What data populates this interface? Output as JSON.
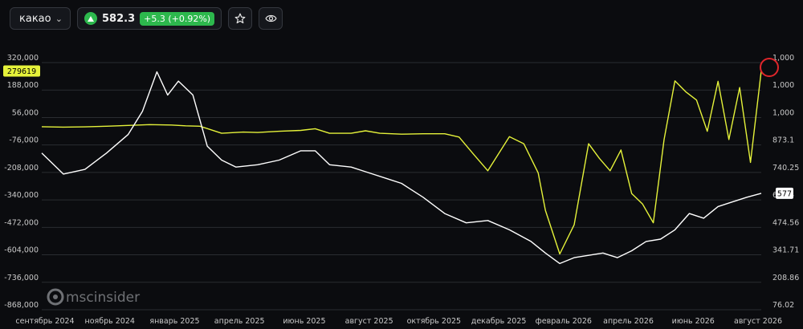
{
  "toolbar": {
    "symbol": "какао",
    "price": "582.3",
    "change": "+5.3 (+0.92%)",
    "colors": {
      "up": "#2db84d"
    }
  },
  "watermark": {
    "text": "mscinsider"
  },
  "chart_data": {
    "type": "line",
    "title": "",
    "x_tick_labels": [
      "сентябрь 2024",
      "ноябрь 2024",
      "январь 2025",
      "апрель 2025",
      "июнь 2025",
      "август 2025",
      "октябрь 2025",
      "декабрь 2025",
      "февраль 2026",
      "апрель 2026",
      "июнь 2026",
      "август 2026"
    ],
    "left_axis": {
      "ticks": [
        "320,000",
        "188,000",
        "56,000",
        "-76,000",
        "-208,000",
        "-340,000",
        "-472,000",
        "-604,000",
        "-736,000",
        "-868,000"
      ],
      "ylim": [
        -868000,
        320000
      ],
      "last_value_label": "279619",
      "last_value_color": "#e5f23a"
    },
    "right_axis": {
      "ticks": [
        "1,000",
        "1,000",
        "1,000",
        "873.1",
        "740.25",
        "607.4",
        "474.56",
        "341.71",
        "208.86",
        "76.02"
      ],
      "ylim": [
        76.02,
        1139.6
      ],
      "last_value_label": "577",
      "last_value_color": "#ffffff"
    },
    "grid": true,
    "series": [
      {
        "axis": "left",
        "color": "#e5f23a",
        "x": [
          0,
          0.03,
          0.06,
          0.09,
          0.12,
          0.15,
          0.18,
          0.2,
          0.22,
          0.25,
          0.28,
          0.3,
          0.33,
          0.36,
          0.38,
          0.4,
          0.43,
          0.45,
          0.47,
          0.5,
          0.53,
          0.56,
          0.58,
          0.6,
          0.62,
          0.65,
          0.67,
          0.69,
          0.7,
          0.72,
          0.74,
          0.76,
          0.775,
          0.79,
          0.805,
          0.82,
          0.835,
          0.85,
          0.865,
          0.88,
          0.895,
          0.91,
          0.925,
          0.94,
          0.955,
          0.97,
          0.985,
          1.0
        ],
        "values": [
          12000,
          10000,
          11000,
          14000,
          18000,
          22000,
          20000,
          16000,
          14000,
          -20000,
          -14000,
          -16000,
          -10000,
          -6000,
          2000,
          -20000,
          -20000,
          -8000,
          -20000,
          -24000,
          -22000,
          -22000,
          -38000,
          -120000,
          -200000,
          -36000,
          -70000,
          -210000,
          -390000,
          -600000,
          -460000,
          -70000,
          -140000,
          -200000,
          -100000,
          -310000,
          -360000,
          -450000,
          -50000,
          232000,
          180000,
          140000,
          -10000,
          230000,
          -50000,
          200000,
          -160000,
          279619
        ]
      },
      {
        "axis": "right",
        "color": "#ffffff",
        "x": [
          0,
          0.03,
          0.06,
          0.09,
          0.12,
          0.14,
          0.16,
          0.175,
          0.19,
          0.21,
          0.23,
          0.25,
          0.27,
          0.3,
          0.33,
          0.36,
          0.38,
          0.4,
          0.43,
          0.45,
          0.48,
          0.5,
          0.53,
          0.56,
          0.59,
          0.62,
          0.65,
          0.68,
          0.7,
          0.72,
          0.74,
          0.76,
          0.78,
          0.8,
          0.82,
          0.84,
          0.86,
          0.88,
          0.9,
          0.92,
          0.94,
          0.96,
          0.98,
          1.0
        ],
        "values": [
          750,
          660,
          680,
          750,
          830,
          930,
          1100,
          1000,
          1060,
          1000,
          780,
          720,
          690,
          700,
          720,
          760,
          760,
          700,
          690,
          670,
          640,
          620,
          560,
          490,
          450,
          460,
          420,
          370,
          320,
          275,
          300,
          310,
          320,
          300,
          330,
          370,
          380,
          420,
          490,
          470,
          520,
          540,
          560,
          577
        ]
      }
    ],
    "annotations": [
      "red circle around latest value of left series"
    ]
  }
}
